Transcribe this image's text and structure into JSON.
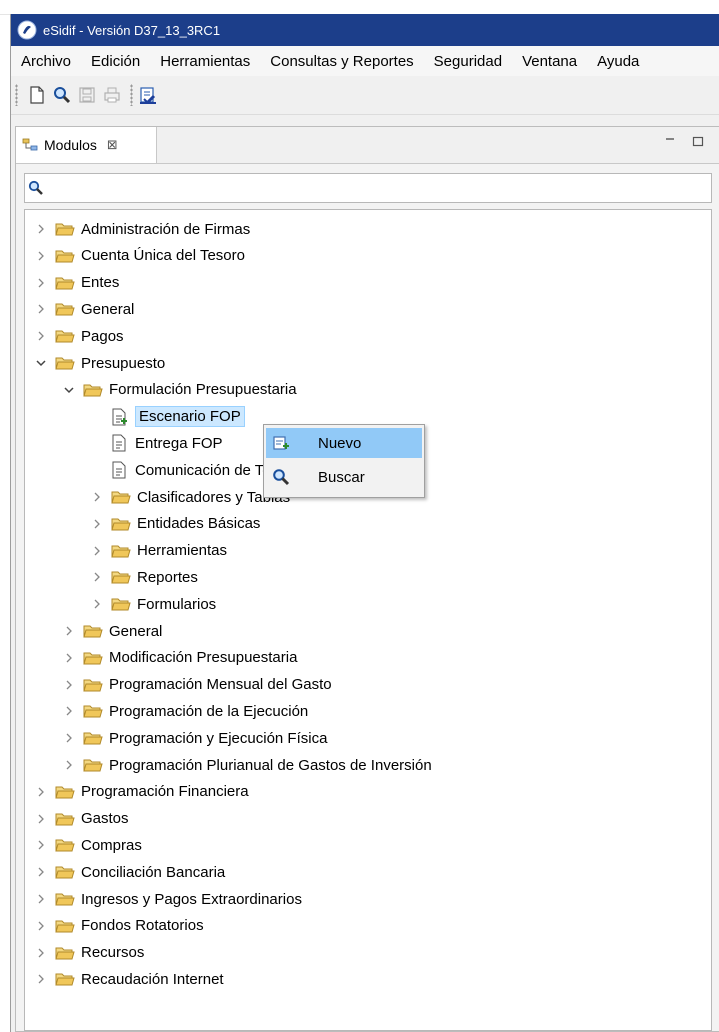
{
  "window": {
    "title": "eSidif - Versión D37_13_3RC1",
    "titlebar_color": "#1c3e8a"
  },
  "menubar": {
    "items": [
      "Archivo",
      "Edición",
      "Herramientas",
      "Consultas y Reportes",
      "Seguridad",
      "Ventana",
      "Ayuda"
    ]
  },
  "toolbar": {
    "buttons": [
      "new-document-icon",
      "search-icon",
      "save-icon",
      "print-icon",
      "refresh-run-icon"
    ]
  },
  "view": {
    "tab_label": "Modulos",
    "tab_close": "⊠",
    "search_value": "",
    "search_placeholder": ""
  },
  "tree": {
    "items": [
      {
        "label": "Administración de Firmas",
        "expanded": false,
        "type": "folder"
      },
      {
        "label": "Cuenta Única del Tesoro",
        "expanded": false,
        "type": "folder"
      },
      {
        "label": "Entes",
        "expanded": false,
        "type": "folder"
      },
      {
        "label": "General",
        "expanded": false,
        "type": "folder"
      },
      {
        "label": "Pagos",
        "expanded": false,
        "type": "folder"
      },
      {
        "label": "Presupuesto",
        "expanded": true,
        "type": "folder"
      },
      {
        "label": "Formulación Presupuestaria",
        "expanded": true,
        "type": "folder"
      },
      {
        "label": "Escenario FOP",
        "type": "document",
        "selected": true
      },
      {
        "label": "Entrega FOP",
        "type": "document"
      },
      {
        "label": "Comunicación de Topes Presupuestarios",
        "type": "document"
      },
      {
        "label": "Clasificadores y Tablas",
        "expanded": false,
        "type": "folder"
      },
      {
        "label": "Entidades Básicas",
        "expanded": false,
        "type": "folder"
      },
      {
        "label": "Herramientas",
        "expanded": false,
        "type": "folder"
      },
      {
        "label": "Reportes",
        "expanded": false,
        "type": "folder"
      },
      {
        "label": "Formularios",
        "expanded": false,
        "type": "folder"
      },
      {
        "label": "General",
        "expanded": false,
        "type": "folder"
      },
      {
        "label": "Modificación Presupuestaria",
        "expanded": false,
        "type": "folder"
      },
      {
        "label": "Programación Mensual del Gasto",
        "expanded": false,
        "type": "folder"
      },
      {
        "label": "Programación de la Ejecución",
        "expanded": false,
        "type": "folder"
      },
      {
        "label": "Programación y Ejecución Física",
        "expanded": false,
        "type": "folder"
      },
      {
        "label": "Programación Plurianual de Gastos de Inversión",
        "expanded": false,
        "type": "folder"
      },
      {
        "label": "Programación Financiera",
        "expanded": false,
        "type": "folder"
      },
      {
        "label": "Gastos",
        "expanded": false,
        "type": "folder"
      },
      {
        "label": "Compras",
        "expanded": false,
        "type": "folder"
      },
      {
        "label": "Conciliación Bancaria",
        "expanded": false,
        "type": "folder"
      },
      {
        "label": "Ingresos y Pagos Extraordinarios",
        "expanded": false,
        "type": "folder"
      },
      {
        "label": "Fondos Rotatorios",
        "expanded": false,
        "type": "folder"
      },
      {
        "label": "Recursos",
        "expanded": false,
        "type": "folder"
      },
      {
        "label": "Recaudación Internet",
        "expanded": false,
        "type": "folder"
      }
    ]
  },
  "context_menu": {
    "items": [
      {
        "label": "Nuevo",
        "icon": "new-item-icon",
        "hovered": true
      },
      {
        "label": "Buscar",
        "icon": "search-icon",
        "hovered": false
      }
    ]
  },
  "colors": {
    "selection_bg": "#cce8ff",
    "menu_hover_bg": "#91c9f7",
    "folder": "#e8c35a"
  }
}
